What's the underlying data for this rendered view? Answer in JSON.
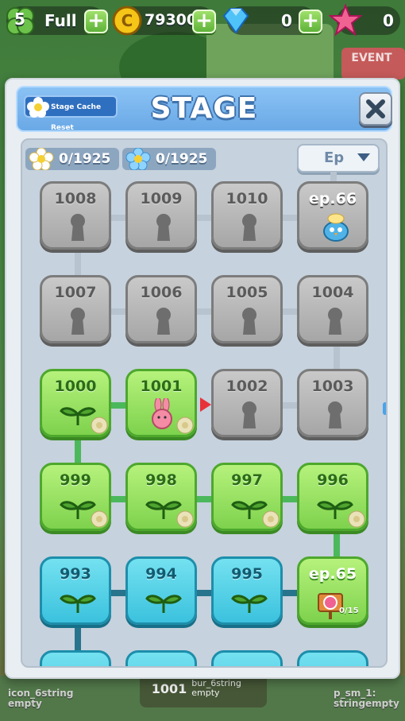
{
  "hud": {
    "clover_count": "5",
    "stamina_label": "Full",
    "coins": "79300",
    "gems": "0",
    "stars": "0"
  },
  "background": {
    "event_label": "EVENT",
    "bottom_left_text": "icon_6string empty",
    "bottom_mid_stage": "1001",
    "bottom_mid_text": "bur_6string empty",
    "bottom_right_text": "p_sm_1: stringempty"
  },
  "dialog": {
    "title": "STAGE",
    "reset_button": "Stage Cache Reset",
    "counter_left": "0/1925",
    "counter_right": "0/1925",
    "ep_dropdown": "Ep"
  },
  "stages": {
    "row1": [
      "1008",
      "1009",
      "1010",
      "ep.66"
    ],
    "row2": [
      "1007",
      "1006",
      "1005",
      "1004"
    ],
    "row3": [
      "1000",
      "1001",
      "1002",
      "1003"
    ],
    "row4": [
      "999",
      "998",
      "997",
      "996"
    ],
    "row5": [
      "993",
      "994",
      "995",
      "ep.65"
    ],
    "ep65_progress": "0/15"
  },
  "colors": {
    "locked": "#a6a6a6",
    "cleared": "#7ed24d",
    "teal": "#3bc2de",
    "header": "#6aa9e6"
  }
}
